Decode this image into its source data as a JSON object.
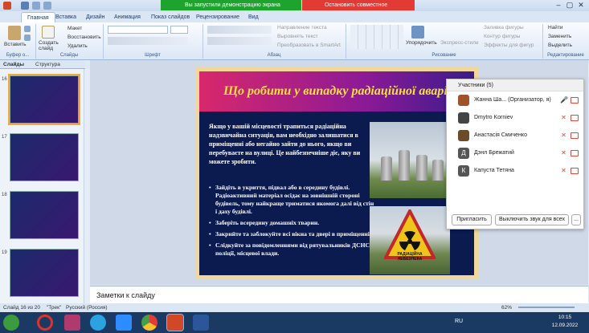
{
  "window": {
    "share_banner": "Вы запустили демонстрацию экрана",
    "stop_share": "Остановить совместное использование"
  },
  "tabs": [
    "Главная",
    "Вставка",
    "Дизайн",
    "Анимация",
    "Показ слайдов",
    "Рецензирование",
    "Вид"
  ],
  "ribbon": {
    "paste": "Вставить",
    "new_slide": "Создать слайд",
    "layout": "Макет",
    "reset": "Восстановить",
    "delete": "Удалить",
    "text_direction": "Направление текста",
    "align_text": "Выровнять текст",
    "smartart": "Преобразовать в SmartArt",
    "arrange": "Упорядочить",
    "quick_styles": "Экспресс-стили",
    "shape_fill": "Заливка фигуры",
    "shape_outline": "Контур фигуры",
    "shape_effects": "Эффекты для фигур",
    "find": "Найти",
    "replace": "Заменить",
    "select": "Выделить",
    "groups": {
      "clipboard": "Буфер о...",
      "slides": "Слайды",
      "font": "Шрифт",
      "paragraph": "Абзац",
      "drawing": "Рисование",
      "editing": "Редактирование"
    }
  },
  "panel_tabs": {
    "slides": "Слайды",
    "outline": "Структура"
  },
  "thumbnails": [
    "16",
    "17",
    "18",
    "19"
  ],
  "slide": {
    "title": "Що робити у випадку радіаційної аварії?",
    "intro": "Якщо у вашій місцевості трапиться радіаційна надзвичайна ситуація, вам необхідно залишатися в приміщенні або негайно зайти до нього, якщо ви перебуваєте на вулиці. Це найбезпечніше діє, яку ви можете зробити.",
    "bullets": [
      "Зайдіть в укриття, підвал або в середину будівлі. Радіоактивний матеріал осідає на зовнішній стороні будівель, тому найкраще триматися якомога далі від стін і даху будівлі.",
      "Заберіть всередину домашніх тварин.",
      "Закрийте та заблокуйте всі вікна та двері в приміщенні.",
      "Слідкуйте за повідомленнями від рятувальників ДСНС, поліції, місцевої влади."
    ],
    "sign_label": "РАДІАЦІЙНА НЕБЕЗПЕКА"
  },
  "notes_placeholder": "Заметки к слайду",
  "status": {
    "slide": "Слайд 16 из 20",
    "theme": "\"Трек\"",
    "language": "Русский (Россия)",
    "zoom": "62%"
  },
  "taskbar": {
    "lang": "RU",
    "time": "10:15",
    "date": "12.09.2022"
  },
  "participants": {
    "header": "Участники (5)",
    "people": [
      {
        "name": "Жанна Ша... (Организатор, я)",
        "initial": "",
        "color": "#a0522d"
      },
      {
        "name": "Dmytro Korniev",
        "initial": "",
        "color": "#444"
      },
      {
        "name": "Анастасія Смиченко",
        "initial": "",
        "color": "#6b4b2a"
      },
      {
        "name": "Дэнл Брежатий",
        "initial": "Д",
        "color": "#555"
      },
      {
        "name": "Капуста Тетяна",
        "initial": "К",
        "color": "#555"
      }
    ],
    "invite": "Пригласить",
    "mute_all": "Выключить звук для всех",
    "more": "..."
  }
}
